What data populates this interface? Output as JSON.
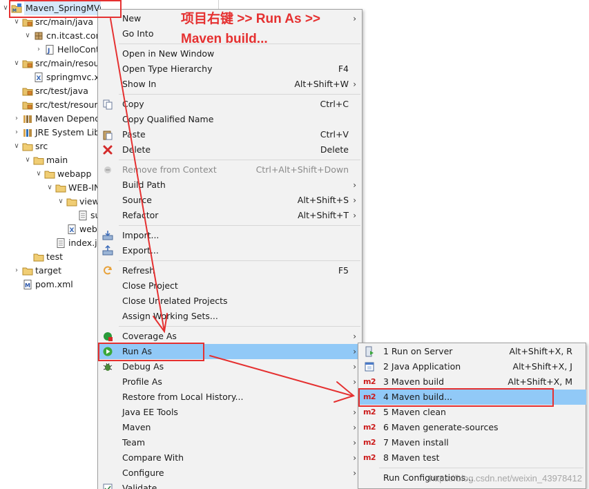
{
  "tree": [
    {
      "label": "Maven_SpringMVC",
      "icon": "project-icon",
      "twistie": "expanded",
      "indent": 0,
      "selected": true
    },
    {
      "label": "src/main/java",
      "icon": "source-folder-icon",
      "twistie": "expanded",
      "indent": 1
    },
    {
      "label": "cn.itcast.cont",
      "icon": "package-icon",
      "twistie": "expanded",
      "indent": 2
    },
    {
      "label": "HelloCont",
      "icon": "java-file-icon",
      "twistie": "collapsed",
      "indent": 3
    },
    {
      "label": "src/main/resour",
      "icon": "source-folder-icon",
      "twistie": "expanded",
      "indent": 1
    },
    {
      "label": "springmvc.xm",
      "icon": "xml-file-icon",
      "twistie": "none",
      "indent": 2
    },
    {
      "label": "src/test/java",
      "icon": "source-folder-icon",
      "twistie": "none",
      "indent": 1
    },
    {
      "label": "src/test/resourc",
      "icon": "source-folder-icon",
      "twistie": "none",
      "indent": 1
    },
    {
      "label": "Maven Depend",
      "icon": "library-icon",
      "twistie": "collapsed",
      "indent": 1
    },
    {
      "label": "JRE System Libr",
      "icon": "jre-library-icon",
      "twistie": "collapsed",
      "indent": 1
    },
    {
      "label": "src",
      "icon": "folder-icon",
      "twistie": "expanded",
      "indent": 1
    },
    {
      "label": "main",
      "icon": "folder-icon",
      "twistie": "expanded",
      "indent": 2
    },
    {
      "label": "webapp",
      "icon": "folder-icon",
      "twistie": "expanded",
      "indent": 3
    },
    {
      "label": "WEB-IN",
      "icon": "folder-icon",
      "twistie": "expanded",
      "indent": 4
    },
    {
      "label": "view",
      "icon": "folder-icon",
      "twistie": "expanded",
      "indent": 5
    },
    {
      "label": "su",
      "icon": "file-icon",
      "twistie": "none",
      "indent": 6
    },
    {
      "label": "web.",
      "icon": "xml-file-icon",
      "twistie": "none",
      "indent": 5
    },
    {
      "label": "index.js",
      "icon": "file-icon",
      "twistie": "none",
      "indent": 4
    },
    {
      "label": "test",
      "icon": "folder-icon",
      "twistie": "none",
      "indent": 2
    },
    {
      "label": "target",
      "icon": "folder-icon",
      "twistie": "collapsed",
      "indent": 1
    },
    {
      "label": "pom.xml",
      "icon": "maven-pom-icon",
      "twistie": "none",
      "indent": 1
    }
  ],
  "menu": [
    {
      "label": "New",
      "accel": "",
      "submenu": true,
      "icon": ""
    },
    {
      "label": "Go Into",
      "accel": "",
      "submenu": false,
      "icon": ""
    },
    {
      "sep": true
    },
    {
      "label": "Open in New Window",
      "accel": "",
      "submenu": false,
      "icon": ""
    },
    {
      "label": "Open Type Hierarchy",
      "accel": "F4",
      "submenu": false,
      "icon": ""
    },
    {
      "label": "Show In",
      "accel": "Alt+Shift+W",
      "submenu": true,
      "icon": ""
    },
    {
      "sep": true
    },
    {
      "label": "Copy",
      "accel": "Ctrl+C",
      "submenu": false,
      "icon": "copy-icon"
    },
    {
      "label": "Copy Qualified Name",
      "accel": "",
      "submenu": false,
      "icon": ""
    },
    {
      "label": "Paste",
      "accel": "Ctrl+V",
      "submenu": false,
      "icon": "paste-icon"
    },
    {
      "label": "Delete",
      "accel": "Delete",
      "submenu": false,
      "icon": "delete-icon"
    },
    {
      "sep": true
    },
    {
      "label": "Remove from Context",
      "accel": "Ctrl+Alt+Shift+Down",
      "submenu": false,
      "icon": "remove-context-icon",
      "disabled": true
    },
    {
      "label": "Build Path",
      "accel": "",
      "submenu": true,
      "icon": ""
    },
    {
      "label": "Source",
      "accel": "Alt+Shift+S",
      "submenu": true,
      "icon": ""
    },
    {
      "label": "Refactor",
      "accel": "Alt+Shift+T",
      "submenu": true,
      "icon": ""
    },
    {
      "sep": true
    },
    {
      "label": "Import...",
      "accel": "",
      "submenu": false,
      "icon": "import-icon"
    },
    {
      "label": "Export...",
      "accel": "",
      "submenu": false,
      "icon": "export-icon"
    },
    {
      "sep": true
    },
    {
      "label": "Refresh",
      "accel": "F5",
      "submenu": false,
      "icon": "refresh-icon"
    },
    {
      "label": "Close Project",
      "accel": "",
      "submenu": false,
      "icon": ""
    },
    {
      "label": "Close Unrelated Projects",
      "accel": "",
      "submenu": false,
      "icon": ""
    },
    {
      "label": "Assign Working Sets...",
      "accel": "",
      "submenu": false,
      "icon": ""
    },
    {
      "sep": true
    },
    {
      "label": "Coverage As",
      "accel": "",
      "submenu": true,
      "icon": "coverage-icon"
    },
    {
      "label": "Run As",
      "accel": "",
      "submenu": true,
      "icon": "run-icon",
      "highlighted": true
    },
    {
      "label": "Debug As",
      "accel": "",
      "submenu": true,
      "icon": "debug-icon"
    },
    {
      "label": "Profile As",
      "accel": "",
      "submenu": true,
      "icon": ""
    },
    {
      "label": "Restore from Local History...",
      "accel": "",
      "submenu": false,
      "icon": ""
    },
    {
      "label": "Java EE Tools",
      "accel": "",
      "submenu": true,
      "icon": ""
    },
    {
      "label": "Maven",
      "accel": "",
      "submenu": true,
      "icon": ""
    },
    {
      "label": "Team",
      "accel": "",
      "submenu": true,
      "icon": ""
    },
    {
      "label": "Compare With",
      "accel": "",
      "submenu": true,
      "icon": ""
    },
    {
      "label": "Configure",
      "accel": "",
      "submenu": true,
      "icon": ""
    },
    {
      "label": "Validate",
      "accel": "",
      "submenu": false,
      "icon": "validate-icon"
    }
  ],
  "run_as_submenu": [
    {
      "label": "1 Run on Server",
      "accel": "Alt+Shift+X, R",
      "icon": "server-icon"
    },
    {
      "label": "2 Java Application",
      "accel": "Alt+Shift+X, J",
      "icon": "java-app-icon"
    },
    {
      "label": "3 Maven build",
      "accel": "Alt+Shift+X, M",
      "icon": "m2-icon"
    },
    {
      "label": "4 Maven build...",
      "accel": "",
      "icon": "m2-icon",
      "highlighted": true
    },
    {
      "label": "5 Maven clean",
      "accel": "",
      "icon": "m2-icon"
    },
    {
      "label": "6 Maven generate-sources",
      "accel": "",
      "icon": "m2-icon"
    },
    {
      "label": "7 Maven install",
      "accel": "",
      "icon": "m2-icon"
    },
    {
      "label": "8 Maven test",
      "accel": "",
      "icon": "m2-icon"
    },
    {
      "sep": true
    },
    {
      "label": "Run Configurations...",
      "accel": "",
      "icon": ""
    }
  ],
  "m2_text": "m2",
  "annotation": {
    "line1": "项目右键 >> Run As >>",
    "line2": "Maven build...",
    "color": "#e53030"
  },
  "watermark": "https://blog.csdn.net/weixin_43978412",
  "colors": {
    "menu_bg": "#f2f2f2",
    "highlight": "#91c9f7",
    "selection": "#d6e8fa",
    "annotation_red": "#e53030"
  }
}
